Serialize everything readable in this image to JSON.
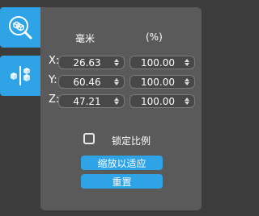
{
  "sidebar": {
    "tabs": [
      {
        "icon": "scale-search-icon",
        "active": true
      },
      {
        "icon": "mirror-icon",
        "active": false
      }
    ]
  },
  "columns": {
    "mm": "毫米",
    "percent": "(%)"
  },
  "rows": [
    {
      "axis": "X:",
      "mm": "26.63",
      "percent": "100.00"
    },
    {
      "axis": "Y:",
      "mm": "60.46",
      "percent": "100.00"
    },
    {
      "axis": "Z:",
      "mm": "47.21",
      "percent": "100.00"
    }
  ],
  "lock_ratio": {
    "label": "锁定比例",
    "checked": false
  },
  "buttons": {
    "fit": "缩放以适应",
    "reset": "重置"
  },
  "colors": {
    "accent": "#2ea3e6",
    "panel": "#5a5a5a",
    "background": "#3c3c3c"
  }
}
